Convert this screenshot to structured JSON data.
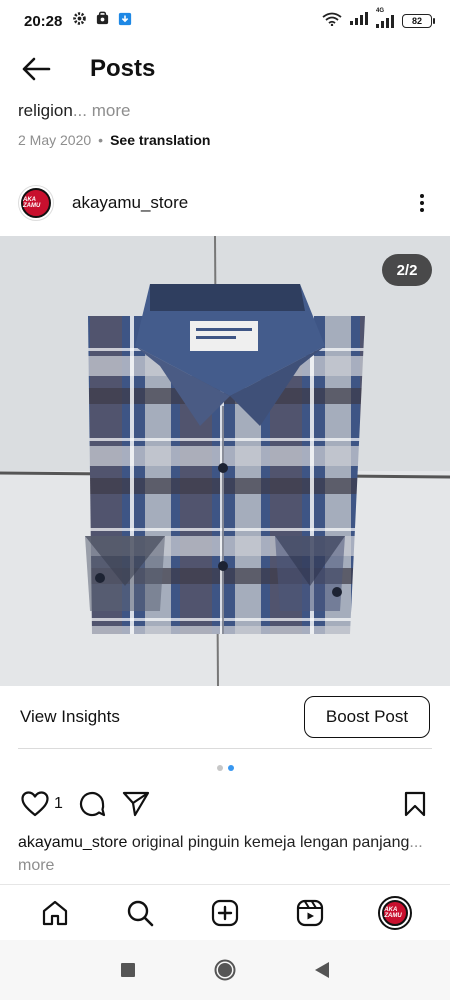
{
  "status_bar": {
    "time": "20:28",
    "battery": "82",
    "network_label": "4G"
  },
  "header": {
    "title": "Posts"
  },
  "previous_post": {
    "caption_tail": "religion",
    "more_label": "... more",
    "date": "2 May 2020",
    "separator": "•",
    "see_translation": "See translation"
  },
  "post": {
    "username": "akayamu_store",
    "avatar_label": "AKA ZAMU",
    "page_indicator": "2/2",
    "view_insights": "View Insights",
    "boost_label": "Boost Post",
    "like_count": "1",
    "carousel": {
      "total": 2,
      "active_index": 1
    },
    "caption_user": "akayamu_store",
    "caption_text": " original pinguin kemeja lengan panjang",
    "caption_more": "... more"
  },
  "bottom_nav": {
    "items": [
      "home",
      "search",
      "create",
      "reels",
      "profile"
    ]
  },
  "colors": {
    "accent_blue": "#3897f0",
    "muted_text": "#8e8e8e",
    "avatar_red": "#c8102e"
  }
}
